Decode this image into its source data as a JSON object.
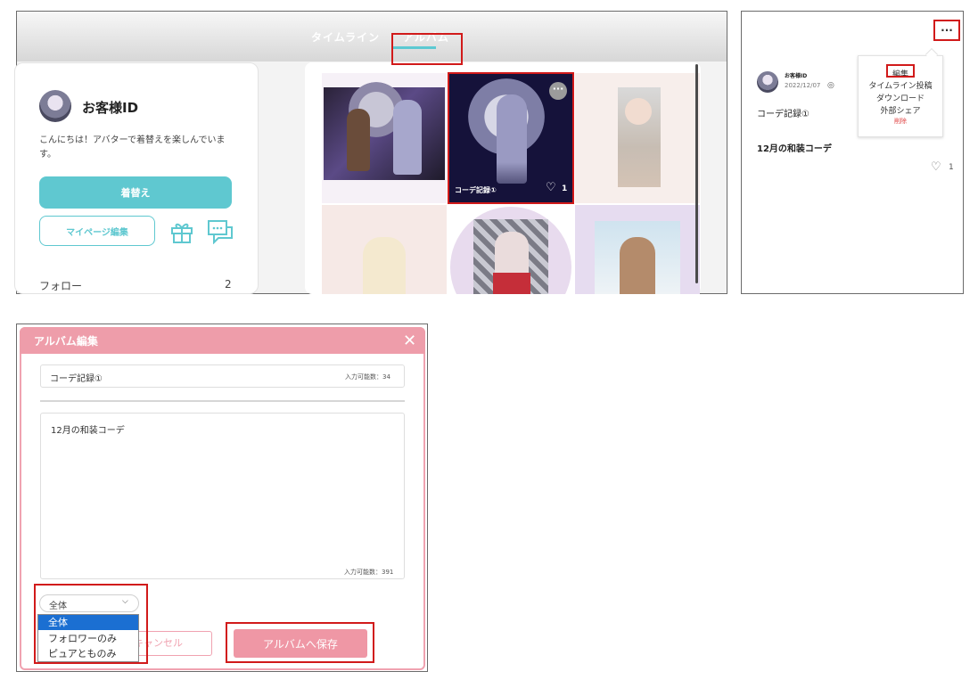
{
  "panel1": {
    "tabs": [
      {
        "label": "タイムライン",
        "active": false
      },
      {
        "label": "アルバム",
        "active": true
      }
    ],
    "profile": {
      "username": "お客様ID",
      "bio": "こんにちは！アバターで着替えを楽しんでいます。",
      "change_button": "着替え",
      "mypage_button": "マイページ編集",
      "gift_icon": "gift-icon",
      "chat_icon": "chat-icon",
      "follow_label": "フォロー",
      "follow_count": "2"
    },
    "selected_item": {
      "title": "コーデ記録①",
      "likes": "1",
      "more_icon": "more-icon"
    },
    "accent_color": "#5fc8d0"
  },
  "panel2": {
    "username": "お客様ID",
    "date": "2022/12/07",
    "visibility_icon": "globe-icon",
    "title": "コーデ記録①",
    "description": "12月の和装コーデ",
    "likes": "1",
    "more_icon": "more-icon",
    "menu": {
      "edit": "編集",
      "post_timeline": "タイムライン投稿",
      "download": "ダウンロード",
      "share": "外部シェア",
      "delete": "削除"
    }
  },
  "panel3": {
    "modal_title": "アルバム編集",
    "close_icon": "close-icon",
    "title_field": {
      "value": "コーデ記録①",
      "counter": "入力可能数：34"
    },
    "desc_field": {
      "value": "12月の和装コーデ",
      "counter": "入力可能数：391"
    },
    "visibility_select": {
      "selected": "全体",
      "options": [
        "全体",
        "フォロワーのみ",
        "ピュアとものみ"
      ]
    },
    "cancel_button": "キャンセル",
    "save_button": "アルバムへ保存",
    "accent_color": "#ef97a5"
  },
  "highlight_color": "#d11a1a"
}
